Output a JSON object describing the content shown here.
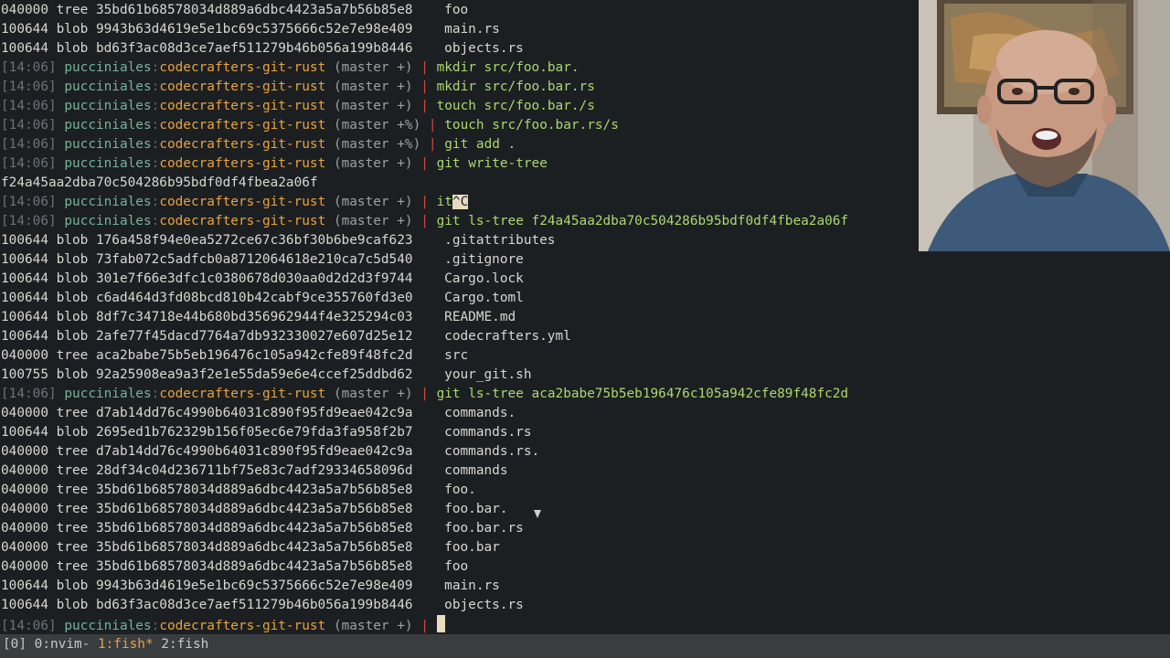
{
  "lines": [
    {
      "t": "out",
      "text": "040000 tree 35bd61b68578034d889a6dbc4423a5a7b56b85e8    foo"
    },
    {
      "t": "out",
      "text": "100644 blob 9943b63d4619e5e1bc69c5375666c52e7e98e409    main.rs"
    },
    {
      "t": "out",
      "text": "100644 blob bd63f3ac08d3ce7aef511279b46b056a199b8446    objects.rs"
    },
    {
      "t": "prompt",
      "ts": "[14:06]",
      "user": "pucciniales",
      "repo": "codecrafters-git-rust",
      "branch": "(master +)",
      "cmd": "mkdir src/foo.bar."
    },
    {
      "t": "prompt",
      "ts": "[14:06]",
      "user": "pucciniales",
      "repo": "codecrafters-git-rust",
      "branch": "(master +)",
      "cmd": "mkdir src/foo.bar.rs"
    },
    {
      "t": "prompt",
      "ts": "[14:06]",
      "user": "pucciniales",
      "repo": "codecrafters-git-rust",
      "branch": "(master +)",
      "cmd": "touch src/foo.bar./s"
    },
    {
      "t": "prompt",
      "ts": "[14:06]",
      "user": "pucciniales",
      "repo": "codecrafters-git-rust",
      "branch": "(master +%)",
      "cmd": "touch src/foo.bar.rs/s"
    },
    {
      "t": "prompt",
      "ts": "[14:06]",
      "user": "pucciniales",
      "repo": "codecrafters-git-rust",
      "branch": "(master +%)",
      "cmd": "git add ."
    },
    {
      "t": "prompt",
      "ts": "[14:06]",
      "user": "pucciniales",
      "repo": "codecrafters-git-rust",
      "branch": "(master +)",
      "cmd": "git write-tree"
    },
    {
      "t": "out",
      "text": "f24a45aa2dba70c504286b95bdf0df4fbea2a06f"
    },
    {
      "t": "prompt",
      "ts": "[14:06]",
      "user": "pucciniales",
      "repo": "codecrafters-git-rust",
      "branch": "(master +)",
      "cmd": "it",
      "hl": "^C"
    },
    {
      "t": "prompt",
      "ts": "[14:06]",
      "user": "pucciniales",
      "repo": "codecrafters-git-rust",
      "branch": "(master +)",
      "cmd": "git ls-tree f24a45aa2dba70c504286b95bdf0df4fbea2a06f"
    },
    {
      "t": "out",
      "text": "100644 blob 176a458f94e0ea5272ce67c36bf30b6be9caf623    .gitattributes"
    },
    {
      "t": "out",
      "text": "100644 blob 73fab072c5adfcb0a8712064618e210ca7c5d540    .gitignore"
    },
    {
      "t": "out",
      "text": "100644 blob 301e7f66e3dfc1c0380678d030aa0d2d2d3f9744    Cargo.lock"
    },
    {
      "t": "out",
      "text": "100644 blob c6ad464d3fd08bcd810b42cabf9ce355760fd3e0    Cargo.toml"
    },
    {
      "t": "out",
      "text": "100644 blob 8df7c34718e44b680bd356962944f4e325294c03    README.md"
    },
    {
      "t": "out",
      "text": "100644 blob 2afe77f45dacd7764a7db932330027e607d25e12    codecrafters.yml"
    },
    {
      "t": "out",
      "text": "040000 tree aca2babe75b5eb196476c105a942cfe89f48fc2d    src"
    },
    {
      "t": "out",
      "text": "100755 blob 92a25908ea9a3f2e1e55da59e6e4ccef25ddbd62    your_git.sh"
    },
    {
      "t": "prompt",
      "ts": "[14:06]",
      "user": "pucciniales",
      "repo": "codecrafters-git-rust",
      "branch": "(master +)",
      "cmd": "git ls-tree aca2babe75b5eb196476c105a942cfe89f48fc2d"
    },
    {
      "t": "out",
      "text": "040000 tree d7ab14dd76c4990b64031c890f95fd9eae042c9a    commands."
    },
    {
      "t": "out",
      "text": "100644 blob 2695ed1b762329b156f05ec6e79fda3fa958f2b7    commands.rs"
    },
    {
      "t": "out",
      "text": "040000 tree d7ab14dd76c4990b64031c890f95fd9eae042c9a    commands.rs."
    },
    {
      "t": "out",
      "text": "040000 tree 28df34c04d236711bf75e83c7adf29334658096d    commands"
    },
    {
      "t": "out",
      "text": "040000 tree 35bd61b68578034d889a6dbc4423a5a7b56b85e8    foo."
    },
    {
      "t": "out",
      "text": "040000 tree 35bd61b68578034d889a6dbc4423a5a7b56b85e8    foo.bar."
    },
    {
      "t": "out",
      "text": "040000 tree 35bd61b68578034d889a6dbc4423a5a7b56b85e8    foo.bar.rs"
    },
    {
      "t": "out",
      "text": "040000 tree 35bd61b68578034d889a6dbc4423a5a7b56b85e8    foo.bar"
    },
    {
      "t": "out",
      "text": "040000 tree 35bd61b68578034d889a6dbc4423a5a7b56b85e8    foo"
    },
    {
      "t": "out",
      "text": "100644 blob 9943b63d4619e5e1bc69c5375666c52e7e98e409    main.rs"
    },
    {
      "t": "out",
      "text": "100644 blob bd63f3ac08d3ce7aef511279b46b056a199b8446    objects.rs"
    },
    {
      "t": "prompt",
      "ts": "[14:06]",
      "user": "pucciniales",
      "repo": "codecrafters-git-rust",
      "branch": "(master +)",
      "cmd": "",
      "cursor": true
    }
  ],
  "statusbar": {
    "session": "[0]",
    "windows": [
      {
        "label": "0:nvim-",
        "active": false
      },
      {
        "label": "1:fish*",
        "active": true
      },
      {
        "label": "2:fish",
        "active": false
      }
    ]
  },
  "colors": {
    "background": "#1c1f22",
    "timestamp": "#6b7379",
    "user": "#74b39a",
    "repo": "#e8a33d",
    "pipe": "#d0473a",
    "command": "#a9d870",
    "statusbar": "#3a3d40"
  }
}
